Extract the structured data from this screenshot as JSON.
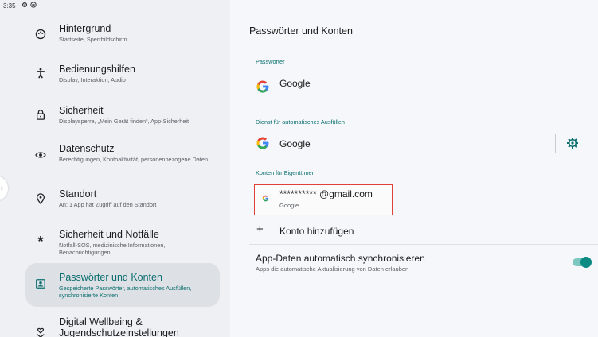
{
  "status_bar": {
    "time": "3:35"
  },
  "settings_nav": [
    {
      "title": "Hintergrund",
      "subtitle": "Startseite, Sperrbildschirm",
      "icon": "palette-icon"
    },
    {
      "title": "Bedienungshilfen",
      "subtitle": "Display, Interaktion, Audio",
      "icon": "accessibility-icon"
    },
    {
      "title": "Sicherheit",
      "subtitle": "Displaysperre, „Mein Gerät finden“, App-Sicherheit",
      "icon": "lock-icon"
    },
    {
      "title": "Datenschutz",
      "subtitle": "Berechtigungen, Kontoaktivität, personenbezogene Daten",
      "icon": "privacy-eye-icon"
    },
    {
      "title": "Standort",
      "subtitle": "An: 1 App hat Zugriff auf den Standort",
      "icon": "location-pin-icon"
    },
    {
      "title": "Sicherheit und Notfälle",
      "subtitle": "Notfall-SOS, medizinische Informationen, Benachrichtigungen",
      "icon": "asterisk-icon"
    },
    {
      "title": "Passwörter und Konten",
      "subtitle": "Gespeicherte Passwörter, automatisches Ausfüllen, synchronisierte Konten",
      "icon": "account-box-icon",
      "selected": true
    },
    {
      "title": "Digital Wellbeing & Jugendschutzeinstellungen",
      "subtitle": "",
      "icon": "wellbeing-icon"
    }
  ],
  "detail": {
    "title": "Passwörter und Konten",
    "passwords": {
      "header": "Passwörter",
      "provider": "Google",
      "provider_sub": "–"
    },
    "autofill": {
      "header": "Dienst für automatisches Ausfüllen",
      "provider": "Google"
    },
    "owner_accounts": {
      "header": "Konten für Eigentümer",
      "email": "********** @gmail.com",
      "account_type": "Google",
      "add_account": "Konto hinzufügen"
    },
    "sync": {
      "title": "App-Daten automatisch synchronisieren",
      "subtitle": "Apps die automatische Aktualisierung von Daten erlauben",
      "enabled": true
    }
  },
  "colors": {
    "accent": "#0b6e6e",
    "highlight_border": "#e0403a",
    "toggle_knob": "#0b8a83"
  }
}
